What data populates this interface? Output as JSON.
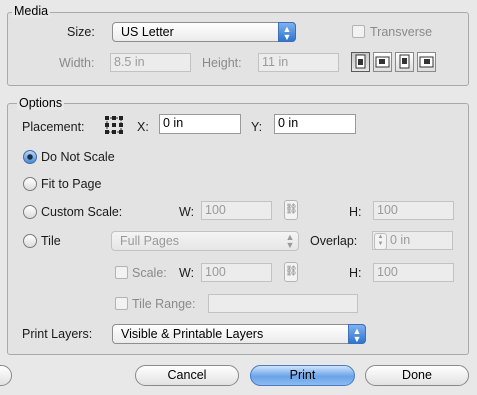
{
  "media": {
    "title": "Media",
    "size_label": "Size:",
    "size_value": "US Letter",
    "transverse_label": "Transverse",
    "width_label": "Width:",
    "width_value": "8.5 in",
    "height_label": "Height:",
    "height_value": "11 in",
    "orientation_icons": [
      "portrait-icon",
      "landscape-icon",
      "portrait-flipped-icon",
      "landscape-flipped-icon"
    ],
    "selected_orientation": 0
  },
  "options": {
    "title": "Options",
    "placement_label": "Placement:",
    "x_label": "X:",
    "x_value": "0 in",
    "y_label": "Y:",
    "y_value": "0 in",
    "do_not_scale": "Do Not Scale",
    "fit_to_page": "Fit to Page",
    "custom_scale": "Custom Scale:",
    "custom_w_label": "W:",
    "custom_w_value": "100",
    "custom_h_label": "H:",
    "custom_h_value": "100",
    "tile": "Tile",
    "tile_mode": "Full Pages",
    "overlap_label": "Overlap:",
    "overlap_value": "0 in",
    "scale_label": "Scale:",
    "scale_w_label": "W:",
    "scale_w_value": "100",
    "scale_h_label": "H:",
    "scale_h_value": "100",
    "tile_range_label": "Tile Range:",
    "tile_range_value": "",
    "selected_scaling": "do_not_scale"
  },
  "print_layers": {
    "label": "Print Layers:",
    "value": "Visible & Printable Layers"
  },
  "buttons": {
    "cancel": "Cancel",
    "print": "Print",
    "done": "Done"
  },
  "colors": {
    "accent": "#4a8ee0",
    "background": "#e8e8e8"
  }
}
